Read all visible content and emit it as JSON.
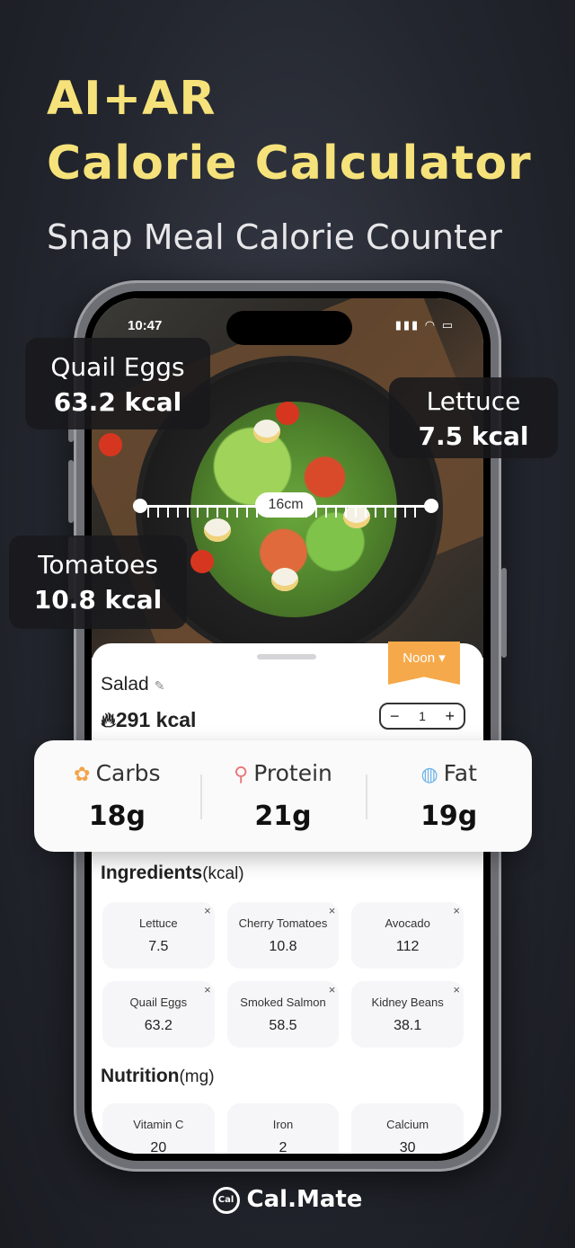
{
  "headline": {
    "line1": "AI+AR",
    "line2": "Calorie Calculator",
    "subtitle": "Snap Meal Calorie Counter"
  },
  "status_bar": {
    "time": "10:47",
    "icons": "▮▮▮ ◠ ▭"
  },
  "ruler": {
    "label": "16cm"
  },
  "tags": [
    {
      "name": "Quail Eggs",
      "value": "63.2 kcal"
    },
    {
      "name": "Lettuce",
      "value": "7.5 kcal"
    },
    {
      "name": "Tomatoes",
      "value": "10.8 kcal"
    }
  ],
  "meal": {
    "time_label": "Noon",
    "time_dropdown_icon": "chevron-down-icon",
    "name": "Salad",
    "edit_icon": "pencil-icon",
    "kcal": "291 kcal",
    "flame_icon": "flame-icon",
    "quantity": "1",
    "minus": "−",
    "plus": "+"
  },
  "macros": [
    {
      "label": "Carbs",
      "value": "18g",
      "icon": "wheat-icon",
      "color": "#f3a34a"
    },
    {
      "label": "Protein",
      "value": "21g",
      "icon": "drumstick-icon",
      "color": "#e87a7a"
    },
    {
      "label": "Fat",
      "value": "19g",
      "icon": "avocado-icon",
      "color": "#6fb3e8"
    }
  ],
  "ingredients": {
    "title": "Ingredients",
    "unit": "(kcal)",
    "items": [
      {
        "name": "Lettuce",
        "value": "7.5"
      },
      {
        "name": "Cherry Tomatoes",
        "value": "10.8"
      },
      {
        "name": "Avocado",
        "value": "112"
      },
      {
        "name": "Quail Eggs",
        "value": "63.2"
      },
      {
        "name": "Smoked Salmon",
        "value": "58.5"
      },
      {
        "name": "Kidney Beans",
        "value": "38.1"
      }
    ]
  },
  "nutrition": {
    "title": "Nutrition",
    "unit": "(mg)",
    "items": [
      {
        "name": "Vitamin C",
        "value": "20"
      },
      {
        "name": "Iron",
        "value": "2"
      },
      {
        "name": "Calcium",
        "value": "30"
      }
    ]
  },
  "brand": {
    "name": "Cal.Mate",
    "logo": "Cal"
  },
  "colors": {
    "headline": "#f6e27a",
    "accent": "#f6a94a"
  }
}
